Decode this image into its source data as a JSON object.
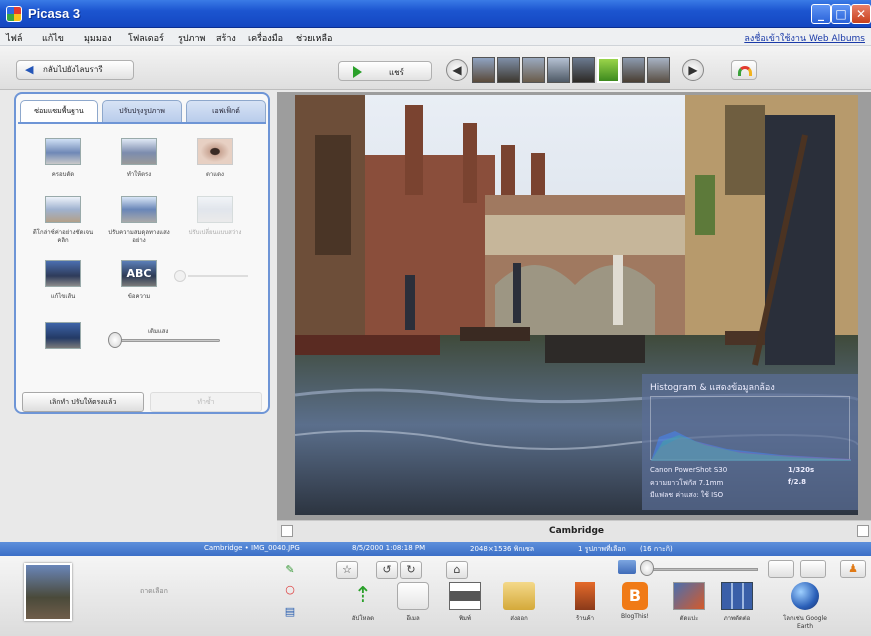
{
  "window": {
    "title": "Picasa 3"
  },
  "menu": {
    "items": [
      "ไฟล์",
      "แก้ไข",
      "มุมมอง",
      "โฟลเดอร์",
      "รูปภาพ",
      "สร้าง",
      "เครื่องมือ",
      "ช่วยเหลือ"
    ],
    "link": "ลงชื่อเข้าใช้งาน Web Albums"
  },
  "toolbar": {
    "back_label": "กลับไปยังไลบรารี",
    "play_label": "แชร์",
    "prev_icon": "left-arrow-icon",
    "next_icon": "right-arrow-icon",
    "meter_icon": "meter-icon"
  },
  "edit_panel": {
    "tabs": [
      "ซ่อมแซมพื้นฐาน",
      "ปรับปรุงรูปภาพ",
      "เอฟเฟ็กต์"
    ],
    "tools": [
      "ครอบตัด",
      "ทำให้ตรง",
      "ตาแดง",
      "ดีโกล่าซ์ค่าอย่างชัดเจน คลิก",
      "ปรับความสมดุลทางแสงอย่าง",
      "ปรับเปลี่ยนแบบสว่าง",
      "แก้ไขเส้น",
      "ข้อความ"
    ],
    "slider_label": "เติมแสง",
    "reset_label": "เลิกทำ ปรับให้ตรงแล้ว",
    "redo_label": "ทำซ้ำ"
  },
  "histogram": {
    "title": "Histogram & แสดงข้อมูลกล้อง",
    "rows": [
      {
        "label": "Canon PowerShot S30",
        "value": "1/320s"
      },
      {
        "label": "ความยาวโฟกัส 7.1mm",
        "value": "f/2.8"
      },
      {
        "label": "มีแฟลช ค่าแสง: ใช้ ISO",
        "value": ""
      }
    ]
  },
  "caption": {
    "text": "Cambridge"
  },
  "status": {
    "file": "Cambridge • IMG_0040.JPG",
    "date": "8/5/2000 1:08:18 PM",
    "size": "2048×1536 พิกเซล",
    "selected": "1 รูปภาพที่เลือก",
    "bytes": "(16 กาะกิ)"
  },
  "tray": {
    "hold_text": "ถาดเลือก",
    "buttons": [
      "อัปโหลด",
      "อีเมล",
      "พิมพ์",
      "ส่งออก",
      "ร้านค้า",
      "BlogThis!",
      "ตัดแปะ",
      "ภาพตัดต่อ",
      "โลกเช่น Google Earth"
    ]
  },
  "colors": {
    "titlebar": "#1c55d0",
    "statusbar": "#4b7fd3",
    "panel_border": "#6e95d6"
  }
}
